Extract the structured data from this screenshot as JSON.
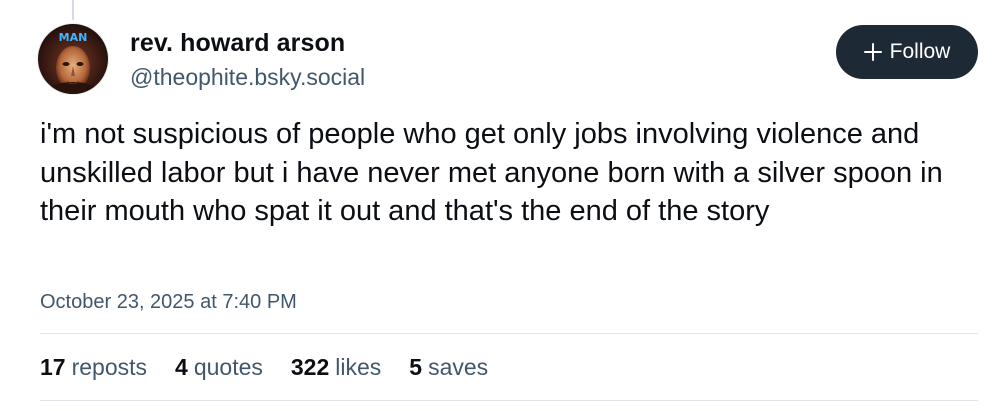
{
  "author": {
    "display_name": "rev. howard arson",
    "handle": "@theophite.bsky.social",
    "avatar_text": "MAN"
  },
  "follow_button": {
    "label": "Follow",
    "icon": "plus-icon"
  },
  "post": {
    "text": "i'm not suspicious of people who get only jobs involving violence and unskilled labor but i have never met anyone born with a silver spoon in their mouth who spat it out and that's the end of the story",
    "timestamp": "October 23, 2025 at 7:40 PM"
  },
  "stats": [
    {
      "count": "17",
      "label": "reposts"
    },
    {
      "count": "4",
      "label": "quotes"
    },
    {
      "count": "322",
      "label": "likes"
    },
    {
      "count": "5",
      "label": "saves"
    }
  ],
  "colors": {
    "button_bg": "#1e2936",
    "secondary_text": "#42576c",
    "primary_text": "#0b0f14",
    "divider": "#dfe5eb"
  }
}
